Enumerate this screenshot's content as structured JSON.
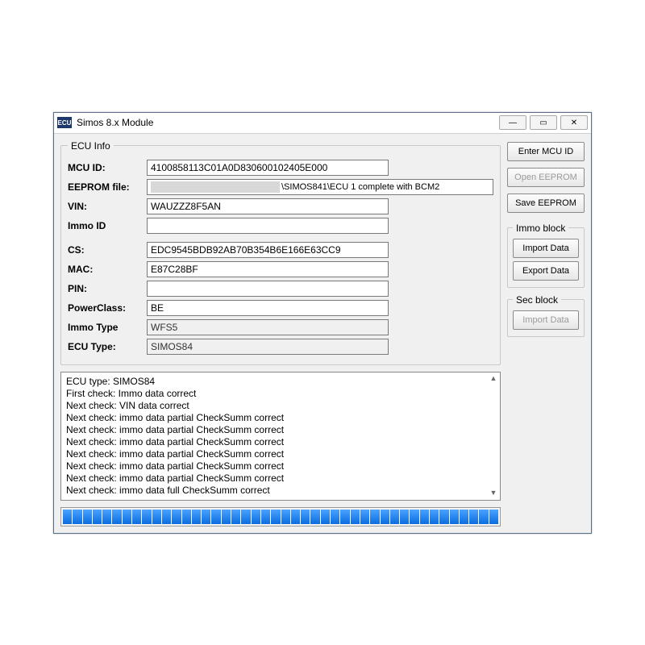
{
  "window": {
    "title": "Simos 8.x Module",
    "app_icon_text": "ECU"
  },
  "ecu_info": {
    "legend": "ECU Info",
    "mcu_id_label": "MCU ID:",
    "mcu_id": "4100858113C01A0D830600102405E000",
    "eeprom_label": "EEPROM file:",
    "eeprom_tail": "\\SIMOS841\\ECU 1 complete with BCM2",
    "vin_label": "VIN:",
    "vin": "WAUZZZ8F5AN",
    "immo_id_label": "Immo ID",
    "immo_id": "",
    "cs_label": "CS:",
    "cs": "EDC9545BDB92AB70B354B6E166E63CC9",
    "mac_label": "MAC:",
    "mac": "E87C28BF",
    "pin_label": "PIN:",
    "pin": "",
    "powerclass_label": "PowerClass:",
    "powerclass": "BE",
    "immo_type_label": "Immo Type",
    "immo_type": "WFS5",
    "ecu_type_label": "ECU Type:",
    "ecu_type": "SIMOS84"
  },
  "buttons": {
    "enter_mcu": "Enter MCU ID",
    "open_eeprom": "Open EEPROM",
    "save_eeprom": "Save EEPROM",
    "immo_legend": "Immo block",
    "immo_import": "Import Data",
    "immo_export": "Export Data",
    "sec_legend": "Sec block",
    "sec_import": "Import Data"
  },
  "log": [
    "ECU type: SIMOS84",
    "First check: Immo data correct",
    "Next check: VIN data correct",
    "Next check: immo data partial CheckSumm correct",
    "Next check: immo data partial CheckSumm correct",
    "Next check: immo data partial CheckSumm correct",
    "Next check: immo data partial CheckSumm correct",
    "Next check: immo data partial CheckSumm correct",
    "Next check: immo data partial CheckSumm correct",
    "Next check: immo data full CheckSumm correct"
  ],
  "progress": {
    "segments": 44,
    "filled": 44
  }
}
